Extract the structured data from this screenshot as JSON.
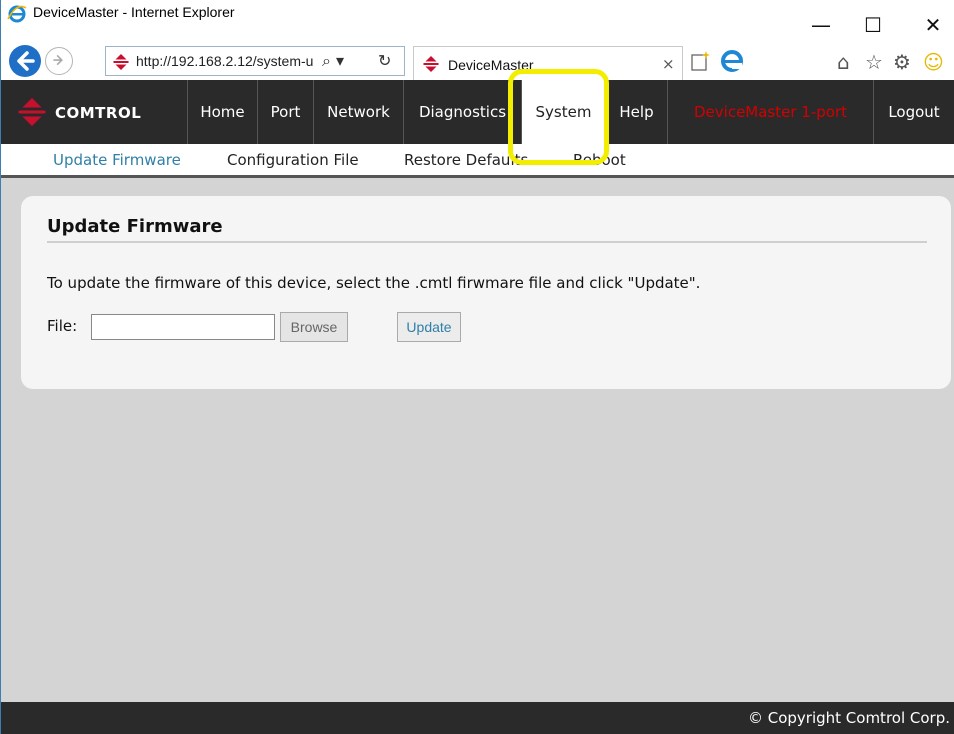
{
  "window": {
    "title": "DeviceMaster - Internet Explorer",
    "controls": {
      "minimize": "—",
      "maximize": "☐",
      "close": "✕"
    }
  },
  "browser": {
    "url": "http://192.168.2.12/system-u",
    "search_glyph": "⌕ ▾",
    "refresh_glyph": "↻",
    "tab_title": "DeviceMaster",
    "tab_close": "×",
    "icons": [
      "ie-icon",
      "back-icon",
      "forward-icon",
      "comtrol-site-icon",
      "new-tab-icon",
      "home-icon",
      "star-icon",
      "gear-icon",
      "smile-icon"
    ],
    "tool_glyphs": {
      "home": "⌂",
      "star": "☆",
      "gear": "⚙",
      "smile": "☺"
    }
  },
  "nav": {
    "logo_text": "COMTROL",
    "items": [
      {
        "label": "Home"
      },
      {
        "label": "Port"
      },
      {
        "label": "Network"
      },
      {
        "label": "Diagnostics"
      },
      {
        "label": "System",
        "active": true
      },
      {
        "label": "Help"
      }
    ],
    "device_label": "DeviceMaster 1-port",
    "logout_label": "Logout",
    "device_color": "#d40000"
  },
  "subnav": {
    "items": [
      {
        "label": "Update Firmware",
        "active": true
      },
      {
        "label": "Configuration File"
      },
      {
        "label": "Restore Defaults"
      },
      {
        "label": "Reboot"
      }
    ]
  },
  "content": {
    "heading": "Update Firmware",
    "instruction": "To update the firmware of this device, select the .cmtl firwmare file and click \"Update\".",
    "file_label": "File:",
    "file_value": "",
    "browse_label": "Browse",
    "update_label": "Update"
  },
  "footer": {
    "copyright": "© Copyright Comtrol Corp."
  },
  "colors": {
    "accent": "#2f7fa8",
    "nav_bg": "#2a2a2a",
    "highlight": "#f3ee00",
    "brand_red": "#c8102e"
  }
}
